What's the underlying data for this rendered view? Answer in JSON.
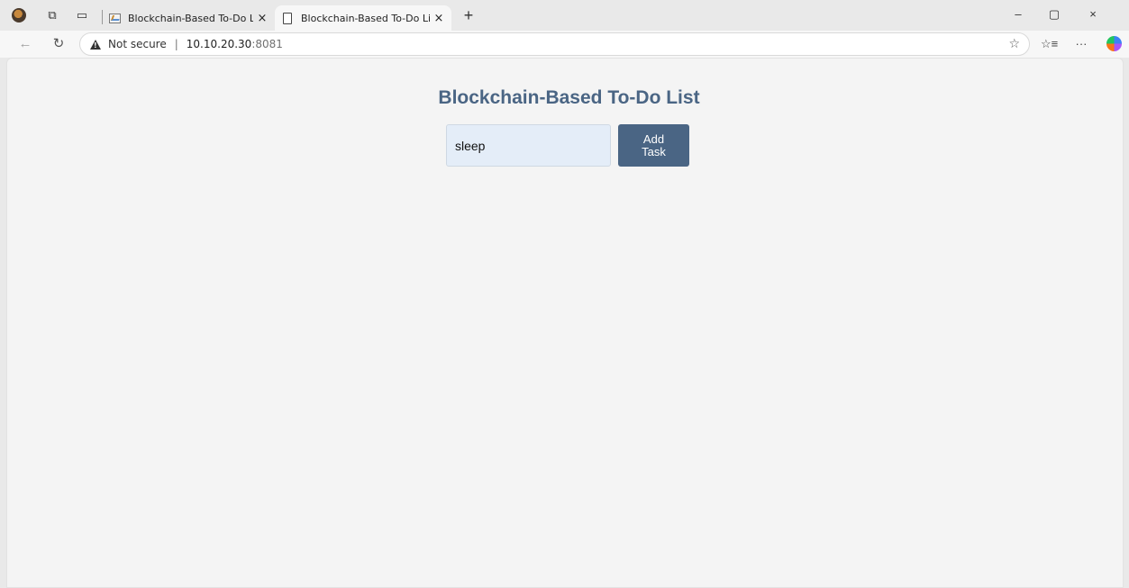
{
  "browser": {
    "tabs": [
      {
        "title": "Blockchain-Based To-Do List",
        "active": false
      },
      {
        "title": "Blockchain-Based To-Do List",
        "active": true
      }
    ],
    "address": {
      "security_label": "Not secure",
      "host": "10.10.20.30",
      "port": ":8081"
    },
    "icons": {
      "close": "×",
      "new_tab": "+",
      "minimize": "–",
      "restore": "▢",
      "window_close": "×",
      "back": "←",
      "refresh": "↻",
      "favorite": "☆",
      "favorites_list": "☆≡",
      "more": "···"
    }
  },
  "page": {
    "title": "Blockchain-Based To-Do List",
    "task_input_value": "sleep",
    "add_button_line1": "Add",
    "add_button_line2": "Task",
    "colors": {
      "accent": "#4a6584",
      "background": "#f4f4f4",
      "input_bg": "#e4edf8"
    }
  }
}
